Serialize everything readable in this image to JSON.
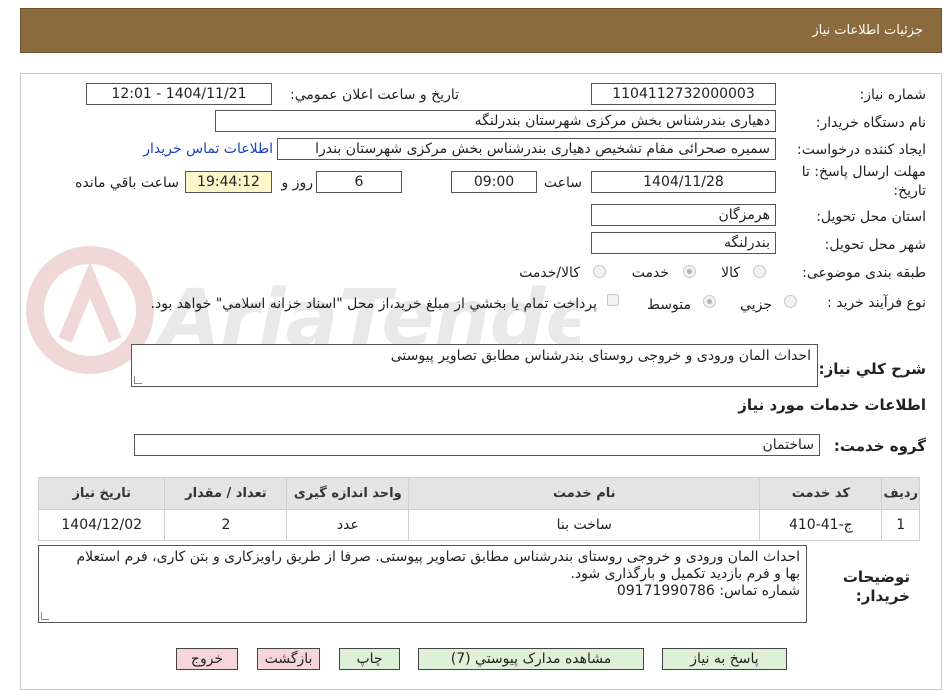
{
  "header": {
    "title": "جزئیات اطلاعات نیاز"
  },
  "form": {
    "need_number_label": "شماره نیاز:",
    "need_number": "1104112732000003",
    "announce_datetime_label": "تاریخ و ساعت اعلان عمومي:",
    "announce_datetime": "1404/11/21 - 12:01",
    "buyer_org_label": "نام دستگاه خريدار:",
    "buyer_org": "دهیاری بندرشناس بخش مرکزی شهرستان بندرلنگه",
    "requester_label": "ايجاد کننده درخواست:",
    "requester": "سمیره صحرائی مقام تشخیص دهیاری بندرشناس بخش مرکزی شهرستان بندرا",
    "buyer_contact_link": "اطلاعات تماس خريدار",
    "deadline_label": "مهلت ارسال پاسخ: تا تاريخ:",
    "deadline_date": "1404/11/28",
    "time_label": "ساعت",
    "deadline_time": "09:00",
    "days_value": "6",
    "days_label": "روز و",
    "remaining_time": "19:44:12",
    "remaining_label": "ساعت باقي مانده",
    "province_label": "استان محل تحويل:",
    "province": "هرمزگان",
    "city_label": "شهر محل تحويل:",
    "city": "بندرلنگه",
    "category_label": "طبقه بندی موضوعی:",
    "category_options": [
      "کالا",
      "خدمت",
      "کالا/خدمت"
    ],
    "purchase_type_label": "نوع فرآیند خرید :",
    "purchase_type_options": [
      "جزيي",
      "متوسط"
    ],
    "payment_note": "پرداخت تمام يا بخشي از مبلغ خريد،از محل \"اسناد خزانه اسلامي\" خواهد بود.",
    "description_label": "شرح کلي نياز:",
    "description": "احداث المان ورودی و خروجی روستای بندرشناس مطابق تصاویر پیوستی",
    "services_title": "اطلاعات خدمات مورد نياز",
    "service_group_label": "گروه خدمت:",
    "service_group": "ساختمان"
  },
  "table": {
    "headers": [
      "رديف",
      "کد خدمت",
      "نام خدمت",
      "واحد اندازه گيری",
      "تعداد / مقدار",
      "تاريخ نياز"
    ],
    "rows": [
      [
        "1",
        "ج-41-410",
        "ساخت بنا",
        "عدد",
        "2",
        "1404/12/02"
      ]
    ]
  },
  "buyer_notes": {
    "label": "توضيحات خريدار:",
    "line1": "احداث المان ورودی و خروجی روستای بندرشناس مطابق تصاویر پیوستی. صرفا از طریق راویزکاری و بتن کاری، فرم استعلام",
    "line2": "بها و فرم بازدید تکمیل و بارگذاری شود.",
    "line3": "شماره تماس: 09171990786"
  },
  "buttons": {
    "reply": "پاسخ به نياز",
    "attachments": "مشاهده مدارک پيوستي (7)",
    "print": "چاپ",
    "back": "بازگشت",
    "exit": "خروج"
  },
  "watermark_text": "AriaTender.neT"
}
